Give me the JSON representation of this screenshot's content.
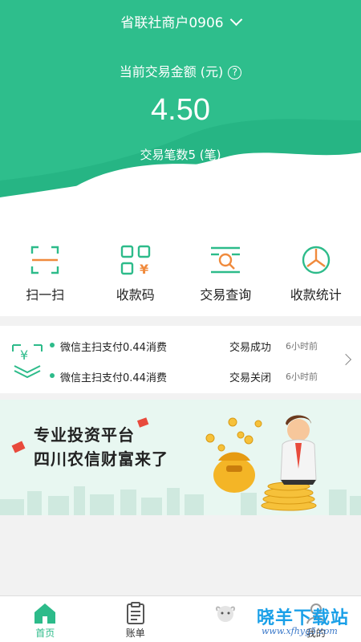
{
  "header": {
    "merchant_name": "省联社商户0906",
    "amount_label": "当前交易金额 (元)",
    "help_icon": "?",
    "amount": "4.50",
    "count_label": "交易笔数5 (笔)"
  },
  "actions": [
    {
      "label": "扫一扫",
      "icon": "scan-icon"
    },
    {
      "label": "收款码",
      "icon": "qr-payment-icon"
    },
    {
      "label": "交易查询",
      "icon": "search-record-icon"
    },
    {
      "label": "收款统计",
      "icon": "pie-chart-icon"
    }
  ],
  "transactions": [
    {
      "desc": "微信主扫支付0.44消费",
      "status": "交易成功",
      "time": "6小时前"
    },
    {
      "desc": "微信主扫支付0.44消费",
      "status": "交易关闭",
      "time": "6小时前"
    }
  ],
  "banner": {
    "line1": "专业投资平台",
    "line2": "四川农信财富来了"
  },
  "tabs": [
    {
      "label": "首页",
      "icon": "home-icon",
      "active": true
    },
    {
      "label": "账单",
      "icon": "clipboard-icon",
      "active": false
    },
    {
      "label": "",
      "icon": "sheep-icon",
      "active": false
    },
    {
      "label": "我的",
      "icon": "user-icon",
      "active": false
    }
  ],
  "watermark": {
    "title": "晓羊下载站",
    "url": "www.xfhyg5.com"
  },
  "colors": {
    "brand_green": "#2dbb8a",
    "banner_bg": "#e8f7f1"
  }
}
